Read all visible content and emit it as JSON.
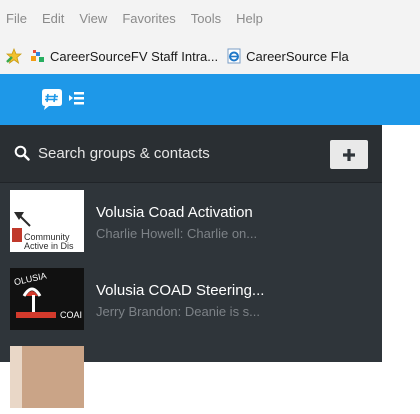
{
  "browser": {
    "menu": [
      "File",
      "Edit",
      "View",
      "Favorites",
      "Tools",
      "Help"
    ],
    "favorites": [
      {
        "label": "CareerSourceFV Staff Intra...",
        "icon": "favorite-site-icon"
      },
      {
        "label": "CareerSource Fla",
        "icon": "ie-page-icon"
      }
    ]
  },
  "app": {
    "header_color": "#1e98e8",
    "logo_icon": "groupme-logo-icon"
  },
  "sidebar": {
    "search": {
      "placeholder": "Search groups & contacts"
    },
    "add_button_icon": "plus-icon",
    "conversations": [
      {
        "title": "Volusia Coad Activation",
        "preview": "Charlie Howell: Charlie on..."
      },
      {
        "title": "Volusia COAD Steering...",
        "preview": "Jerry Brandon: Deanie is s..."
      }
    ]
  },
  "colors": {
    "sidebar_bg": "#2f353a",
    "search_bg": "#2a2f33",
    "preview_text": "#7d8287"
  }
}
